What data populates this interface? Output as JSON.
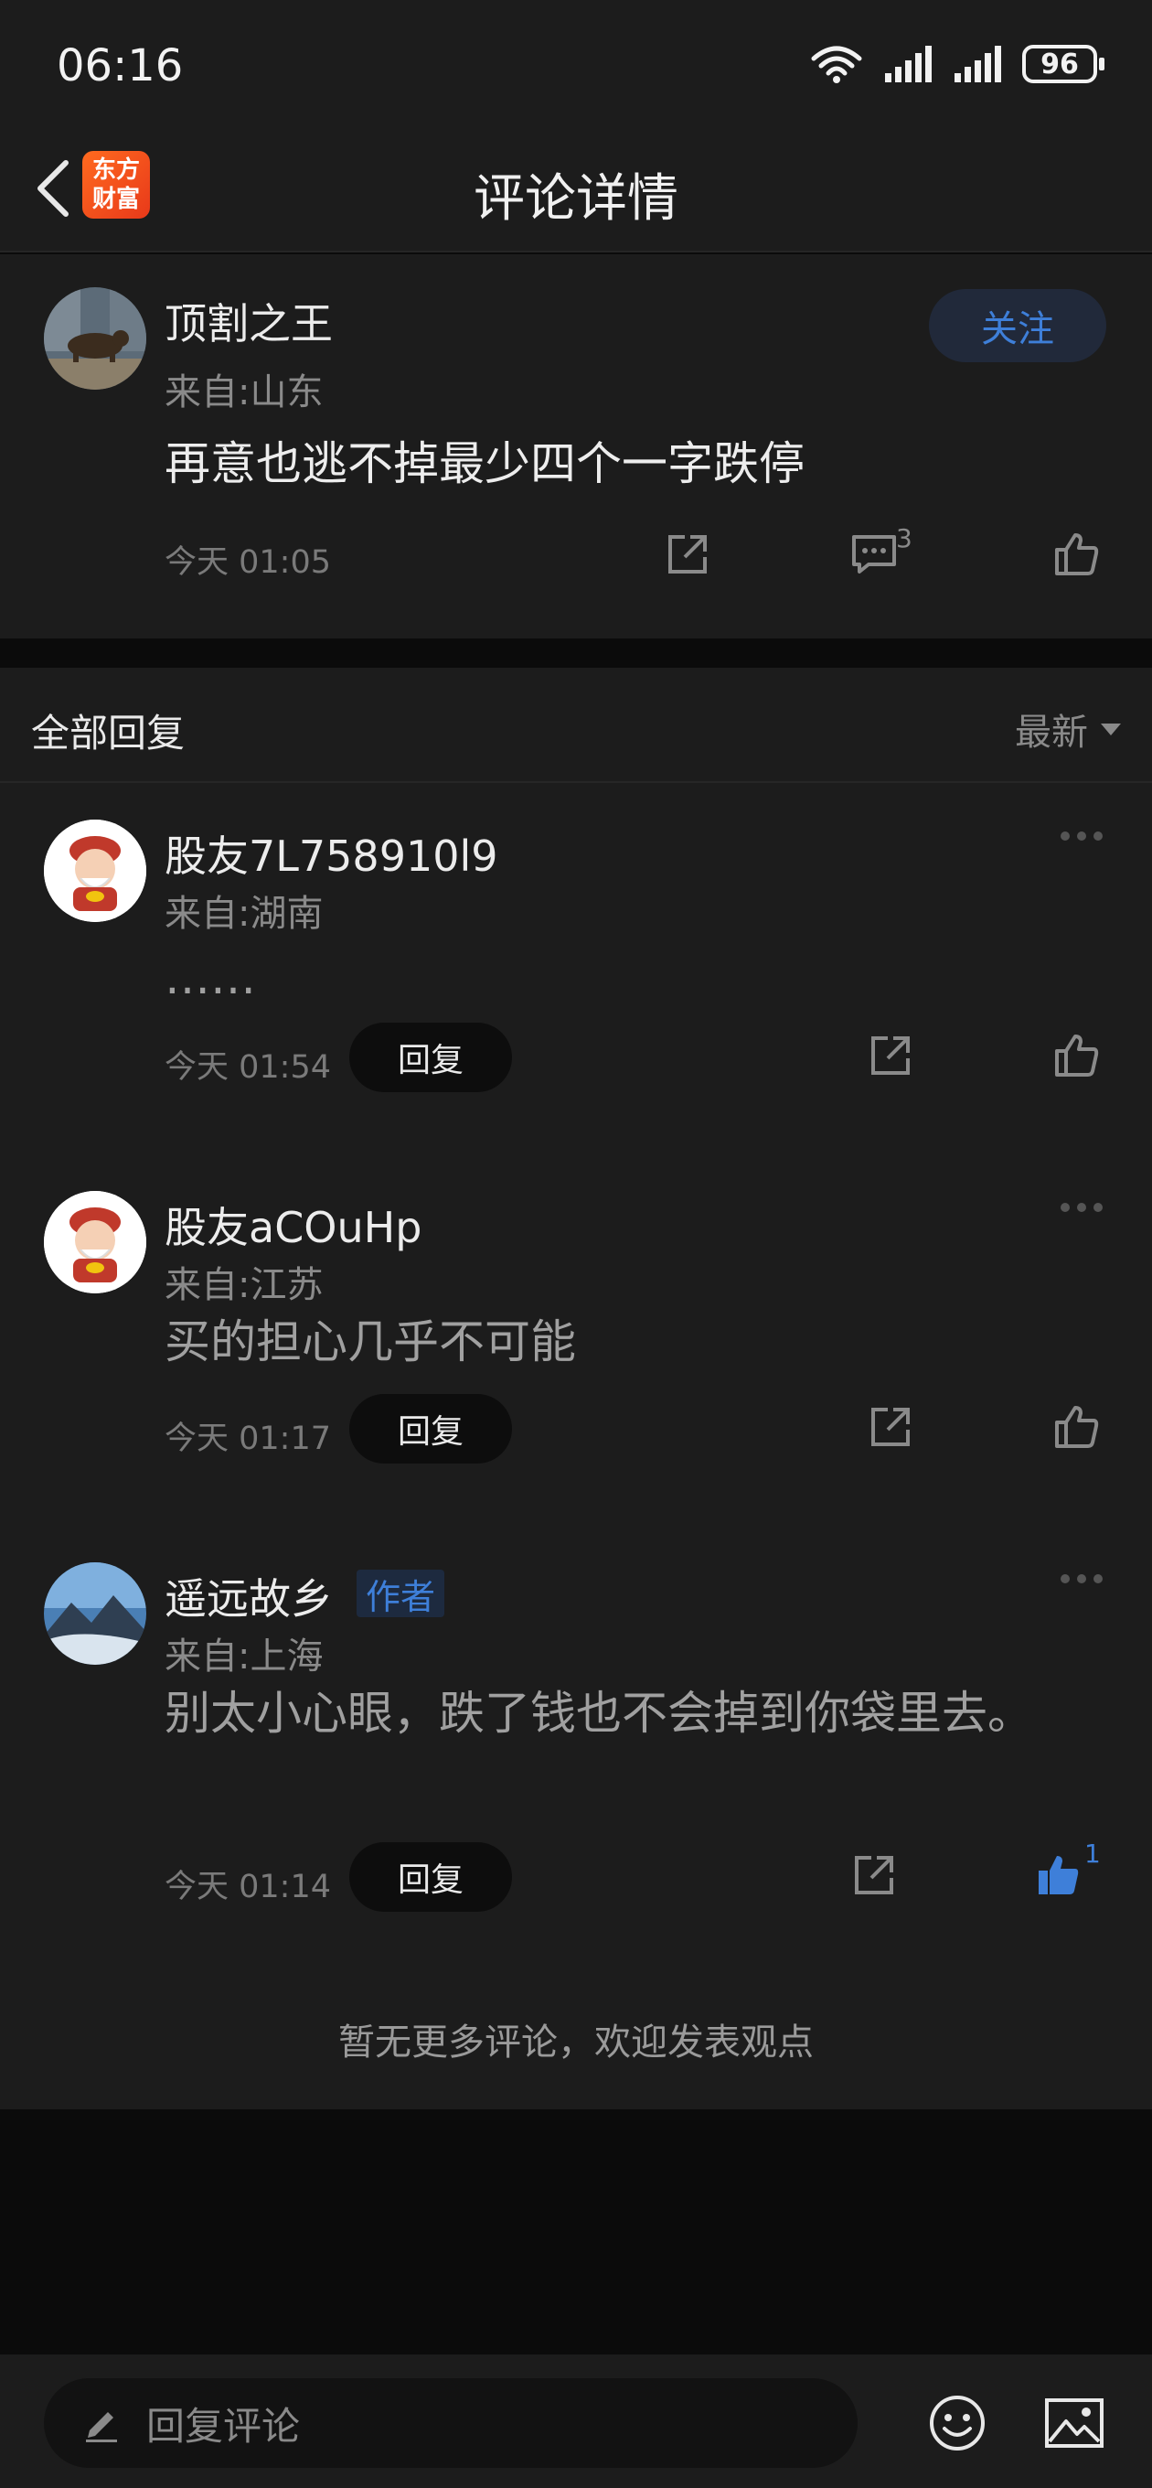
{
  "status_bar": {
    "time": "06:16",
    "battery": "96"
  },
  "header": {
    "title": "评论详情",
    "logo_text_1": "东方",
    "logo_text_2": "财富"
  },
  "post": {
    "username": "顶割之王",
    "location": "来自:山东",
    "content": "再意也逃不掉最少四个一字跌停",
    "timestamp": "今天 01:05",
    "follow_label": "关注",
    "comment_count": "3"
  },
  "replies": {
    "title": "全部回复",
    "sort_label": "最新",
    "reply_label": "回复",
    "items": [
      {
        "username": "股友7L758910l9",
        "location": "来自:湖南",
        "content": "……",
        "timestamp": "今天 01:54"
      },
      {
        "username": "股友aCOuHp",
        "location": "来自:江苏",
        "content": "买的担心几乎不可能",
        "timestamp": "今天 01:17"
      },
      {
        "username": "遥远故乡",
        "badge": "作者",
        "location": "来自:上海",
        "content": "别太小心眼，跌了钱也不会掉到你袋里去。",
        "timestamp": "今天 01:14",
        "like_count": "1"
      }
    ],
    "footer_note": "暂无更多评论，欢迎发表观点"
  },
  "bottom_bar": {
    "placeholder": "回复评论"
  },
  "colors": {
    "background": "#1c1c1c",
    "accent": "#3e7fd9",
    "brand": "#ff6a1f"
  }
}
